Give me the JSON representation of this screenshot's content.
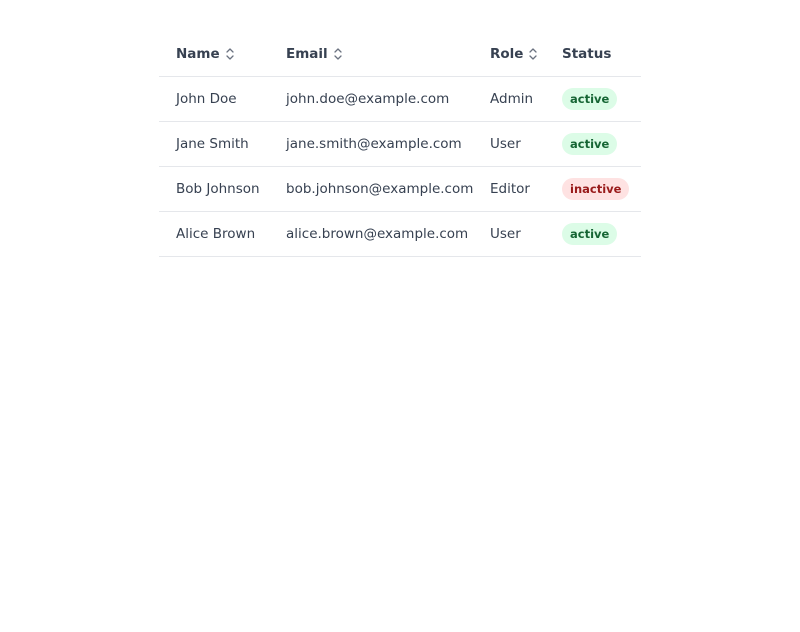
{
  "table": {
    "headers": {
      "name": "Name",
      "email": "Email",
      "role": "Role",
      "status": "Status"
    },
    "sortable": [
      "name",
      "email",
      "role"
    ],
    "rows": [
      {
        "name": "John Doe",
        "email": "john.doe@example.com",
        "role": "Admin",
        "status": "active"
      },
      {
        "name": "Jane Smith",
        "email": "jane.smith@example.com",
        "role": "User",
        "status": "active"
      },
      {
        "name": "Bob Johnson",
        "email": "bob.johnson@example.com",
        "role": "Editor",
        "status": "inactive"
      },
      {
        "name": "Alice Brown",
        "email": "alice.brown@example.com",
        "role": "User",
        "status": "active"
      }
    ]
  },
  "colors": {
    "active_bg": "#dcfce7",
    "active_text": "#166534",
    "inactive_bg": "#fee2e2",
    "inactive_text": "#991b1b",
    "text": "#374151",
    "divider": "#e5e7eb"
  },
  "icons": {
    "sort": "sort-chevrons-icon"
  }
}
